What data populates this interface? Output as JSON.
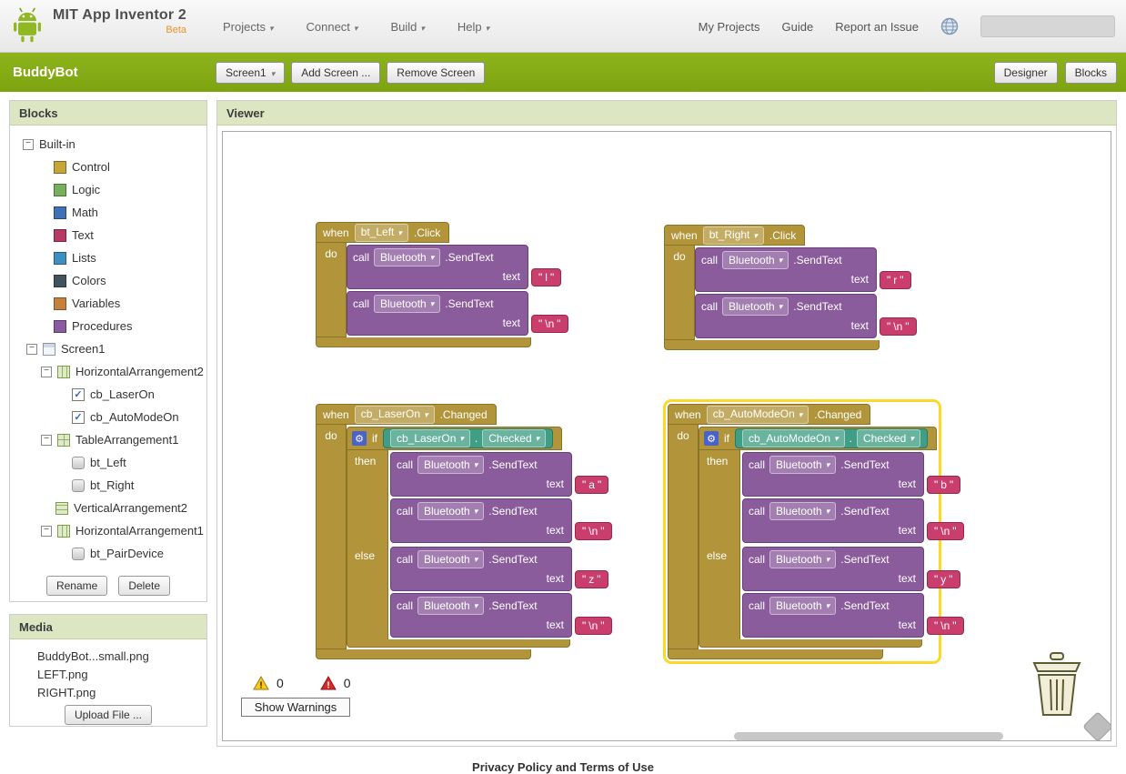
{
  "header": {
    "app_title": "MIT App Inventor 2",
    "beta": "Beta",
    "menus": [
      {
        "label": "Projects"
      },
      {
        "label": "Connect"
      },
      {
        "label": "Build"
      },
      {
        "label": "Help"
      }
    ],
    "links": [
      {
        "label": "My Projects"
      },
      {
        "label": "Guide"
      },
      {
        "label": "Report an Issue"
      }
    ]
  },
  "toolbar": {
    "project_name": "BuddyBot",
    "screen_selector": "Screen1",
    "add_screen": "Add Screen ...",
    "remove_screen": "Remove Screen",
    "designer": "Designer",
    "blocks": "Blocks"
  },
  "palette": {
    "title": "Blocks",
    "builtin_label": "Built-in",
    "builtin": [
      {
        "label": "Control",
        "color": "#c7a437"
      },
      {
        "label": "Logic",
        "color": "#76b05c"
      },
      {
        "label": "Math",
        "color": "#3f71b5"
      },
      {
        "label": "Text",
        "color": "#b73a62"
      },
      {
        "label": "Lists",
        "color": "#3c8fc0"
      },
      {
        "label": "Colors",
        "color": "#41535e"
      },
      {
        "label": "Variables",
        "color": "#c5813c"
      },
      {
        "label": "Procedures",
        "color": "#8a5ba0"
      }
    ]
  },
  "components": {
    "screen": "Screen1",
    "horizontal_arrangement2": "HorizontalArrangement2",
    "cb_laseron": "cb_LaserOn",
    "cb_automodeon": "cb_AutoModeOn",
    "table_arrangement1": "TableArrangement1",
    "bt_left": "bt_Left",
    "bt_right": "bt_Right",
    "vertical_arrangement2": "VerticalArrangement2",
    "horizontal_arrangement1": "HorizontalArrangement1",
    "bt_pairdevice": "bt_PairDevice",
    "rename": "Rename",
    "delete": "Delete"
  },
  "media": {
    "title": "Media",
    "files": [
      {
        "name": "BuddyBot...small.png"
      },
      {
        "name": "LEFT.png"
      },
      {
        "name": "RIGHT.png"
      }
    ],
    "upload": "Upload File ..."
  },
  "viewer": {
    "title": "Viewer",
    "warning_count": "0",
    "error_count": "0",
    "show_warnings": "Show Warnings"
  },
  "kw": {
    "when": "when",
    "do": "do",
    "call": "call",
    "text": "text",
    "if": "if",
    "then": "then",
    "else": "else",
    "dot": ".",
    "quote": "\""
  },
  "icons": {
    "gear": "⚙"
  },
  "block1": {
    "component": "bt_Left",
    "event": ".Click",
    "calls": [
      {
        "comp": "Bluetooth",
        "method": ".SendText",
        "arg": "l"
      },
      {
        "comp": "Bluetooth",
        "method": ".SendText",
        "arg": "\\n"
      }
    ]
  },
  "block2": {
    "component": "bt_Right",
    "event": ".Click",
    "calls": [
      {
        "comp": "Bluetooth",
        "method": ".SendText",
        "arg": "r"
      },
      {
        "comp": "Bluetooth",
        "method": ".SendText",
        "arg": "\\n"
      }
    ]
  },
  "block3": {
    "component": "cb_LaserOn",
    "event": ".Changed",
    "cond": {
      "comp": "cb_LaserOn",
      "prop": "Checked"
    },
    "then_calls": [
      {
        "comp": "Bluetooth",
        "method": ".SendText",
        "arg": "a"
      },
      {
        "comp": "Bluetooth",
        "method": ".SendText",
        "arg": "\\n"
      }
    ],
    "else_calls": [
      {
        "comp": "Bluetooth",
        "method": ".SendText",
        "arg": "z"
      },
      {
        "comp": "Bluetooth",
        "method": ".SendText",
        "arg": "\\n"
      }
    ]
  },
  "block4": {
    "component": "cb_AutoModeOn",
    "event": ".Changed",
    "cond": {
      "comp": "cb_AutoModeOn",
      "prop": "Checked"
    },
    "then_calls": [
      {
        "comp": "Bluetooth",
        "method": ".SendText",
        "arg": "b"
      },
      {
        "comp": "Bluetooth",
        "method": ".SendText",
        "arg": "\\n"
      }
    ],
    "else_calls": [
      {
        "comp": "Bluetooth",
        "method": ".SendText",
        "arg": "y"
      },
      {
        "comp": "Bluetooth",
        "method": ".SendText",
        "arg": "\\n"
      }
    ]
  },
  "footer": {
    "privacy": "Privacy Policy and Terms of Use"
  }
}
